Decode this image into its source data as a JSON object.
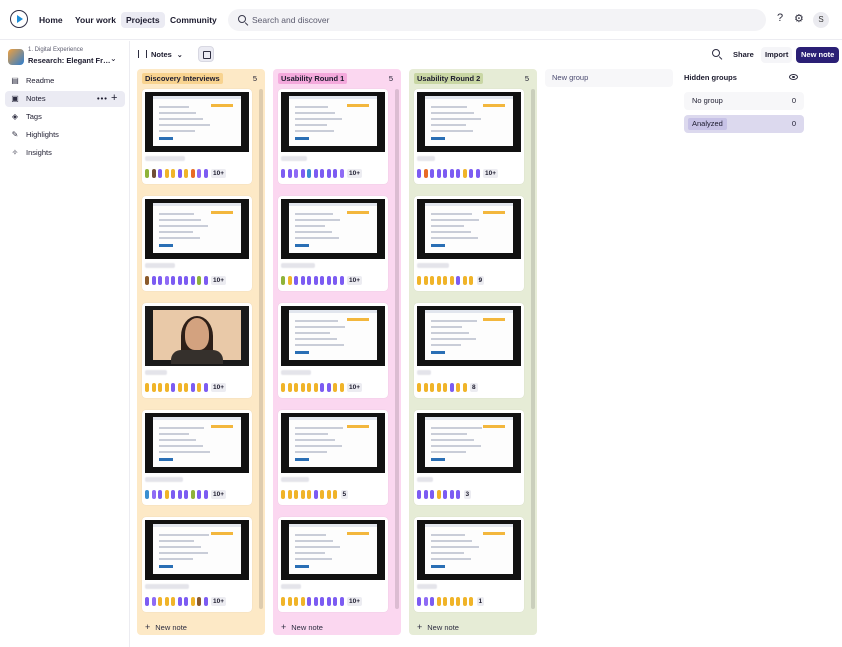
{
  "nav": {
    "home": "Home",
    "your_work": "Your work",
    "projects": "Projects",
    "community": "Community",
    "search_placeholder": "Search and discover",
    "help": "?",
    "settings": "⚙",
    "user_initial": "S"
  },
  "sidebar": {
    "project_sub": "1. Digital Experience",
    "project_title": "Research: Elegant Fr…",
    "items": [
      {
        "label": "Readme",
        "icon": "book-icon",
        "glyph": "▤"
      },
      {
        "label": "Notes",
        "icon": "notes-icon",
        "glyph": "▣"
      },
      {
        "label": "Tags",
        "icon": "tag-icon",
        "glyph": "◈"
      },
      {
        "label": "Highlights",
        "icon": "highlight-icon",
        "glyph": "✎"
      },
      {
        "label": "Insights",
        "icon": "sparkle-icon",
        "glyph": "✧"
      }
    ]
  },
  "toolbar": {
    "view_label": "Notes",
    "share": "Share",
    "import": "Import",
    "new_note": "New note"
  },
  "columns": [
    {
      "name": "Discovery Interviews",
      "count": "5",
      "bg": "#fde9c6",
      "head_bg": "#f8d38f",
      "cards": [
        {
          "tags": [
            "#8fb339",
            "#6f4e37",
            "#7c5cf2",
            "#f0b429",
            "#f0b429",
            "#7c5cf2",
            "#f0b429",
            "#e86b25",
            "#8f6bf5",
            "#7c5cf2"
          ],
          "count": "10+",
          "thumb": "screen"
        },
        {
          "tags": [
            "#8a5a2b",
            "#7c5cf2",
            "#7c5cf2",
            "#8f6bf5",
            "#7c5cf2",
            "#7c5cf2",
            "#7c5cf2",
            "#7c5cf2",
            "#8fb339",
            "#7c5cf2"
          ],
          "count": "10+",
          "thumb": "screen"
        },
        {
          "tags": [
            "#f0b429",
            "#f0b429",
            "#f0b429",
            "#f0b429",
            "#7c5cf2",
            "#f0b429",
            "#f0b429",
            "#7c5cf2",
            "#f0b429",
            "#7c5cf2"
          ],
          "count": "10+",
          "thumb": "person"
        },
        {
          "tags": [
            "#3a8fd1",
            "#8f6bf5",
            "#7c5cf2",
            "#f0b429",
            "#7c5cf2",
            "#7c5cf2",
            "#7c5cf2",
            "#8fb339",
            "#7c5cf2",
            "#7c5cf2"
          ],
          "count": "10+",
          "thumb": "screen"
        },
        {
          "tags": [
            "#7c5cf2",
            "#8f6bf5",
            "#f0b429",
            "#f0b429",
            "#f0b429",
            "#7c5cf2",
            "#7c5cf2",
            "#f0b429",
            "#8a5a2b",
            "#7c5cf2"
          ],
          "count": "10+",
          "thumb": "screen"
        }
      ],
      "footer": "New note"
    },
    {
      "name": "Usability Round 1",
      "count": "5",
      "bg": "#fbd7f0",
      "head_bg": "#f4a9dc",
      "cards": [
        {
          "tags": [
            "#7c5cf2",
            "#7c5cf2",
            "#8f6bf5",
            "#7c5cf2",
            "#3a8fd1",
            "#7c5cf2",
            "#7c5cf2",
            "#7c5cf2",
            "#7c5cf2",
            "#8f6bf5"
          ],
          "count": "10+",
          "thumb": "screen"
        },
        {
          "tags": [
            "#8fb339",
            "#f0b429",
            "#7c5cf2",
            "#7c5cf2",
            "#7c5cf2",
            "#7c5cf2",
            "#7c5cf2",
            "#7c5cf2",
            "#7c5cf2",
            "#7c5cf2"
          ],
          "count": "10+",
          "thumb": "screen"
        },
        {
          "tags": [
            "#f0b429",
            "#f0b429",
            "#f0b429",
            "#f0b429",
            "#f0b429",
            "#f0b429",
            "#7c5cf2",
            "#7c5cf2",
            "#f0b429",
            "#f0b429"
          ],
          "count": "10+",
          "thumb": "screen"
        },
        {
          "tags": [
            "#f0b429",
            "#f0b429",
            "#f0b429",
            "#f0b429",
            "#f0b429",
            "#7c5cf2",
            "#f0b429",
            "#f0b429",
            "#f0b429"
          ],
          "count": "5",
          "thumb": "screen"
        },
        {
          "tags": [
            "#f0b429",
            "#f0b429",
            "#f0b429",
            "#f0b429",
            "#7c5cf2",
            "#7c5cf2",
            "#7c5cf2",
            "#7c5cf2",
            "#7c5cf2",
            "#7c5cf2"
          ],
          "count": "10+",
          "thumb": "screen"
        }
      ],
      "footer": "New note"
    },
    {
      "name": "Usability Round 2",
      "count": "5",
      "bg": "#e6ecd6",
      "head_bg": "#c9d7a4",
      "cards": [
        {
          "tags": [
            "#7c5cf2",
            "#e86b25",
            "#7c5cf2",
            "#7c5cf2",
            "#7c5cf2",
            "#7c5cf2",
            "#7c5cf2",
            "#f0b429",
            "#7c5cf2",
            "#7c5cf2"
          ],
          "count": "10+",
          "thumb": "screen"
        },
        {
          "tags": [
            "#f0b429",
            "#f0b429",
            "#f0b429",
            "#f0b429",
            "#f0b429",
            "#f0b429",
            "#7c5cf2",
            "#f0b429",
            "#f0b429"
          ],
          "count": "9",
          "thumb": "screen"
        },
        {
          "tags": [
            "#f0b429",
            "#f0b429",
            "#f0b429",
            "#f0b429",
            "#f0b429",
            "#7c5cf2",
            "#f0b429",
            "#f0b429"
          ],
          "count": "8",
          "thumb": "screen"
        },
        {
          "tags": [
            "#7c5cf2",
            "#7c5cf2",
            "#7c5cf2",
            "#f0b429",
            "#7c5cf2",
            "#7c5cf2",
            "#7c5cf2"
          ],
          "count": "3",
          "thumb": "screen"
        },
        {
          "tags": [
            "#7c5cf2",
            "#8f6bf5",
            "#7c5cf2",
            "#f0b429",
            "#f0b429",
            "#f0b429",
            "#f0b429",
            "#f0b429",
            "#f0b429"
          ],
          "count": "1",
          "thumb": "screen"
        }
      ],
      "footer": "New note"
    }
  ],
  "new_group": "New group",
  "hidden_groups": {
    "title": "Hidden groups",
    "groups": [
      {
        "label": "No group",
        "count": "0",
        "bg": "#f7f7f9",
        "label_bg": "transparent"
      },
      {
        "label": "Analyzed",
        "count": "0",
        "bg": "#dcd9ee",
        "label_bg": "#c7c2e6"
      }
    ]
  }
}
